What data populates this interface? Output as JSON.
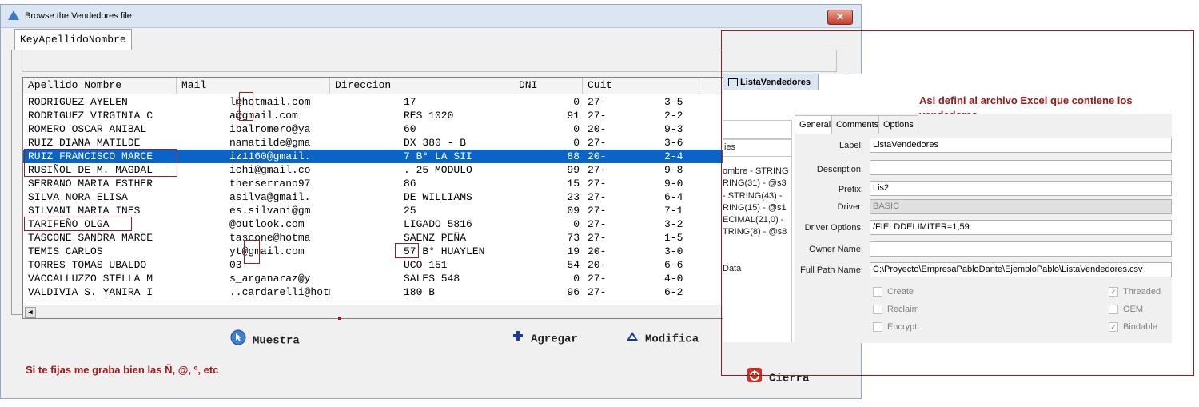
{
  "window": {
    "title": "Browse the Vendedores file",
    "close_label": "✕"
  },
  "tab": {
    "label": "KeyApellidoNombre"
  },
  "grid": {
    "columns": [
      "Apellido Nombre",
      "Mail",
      "Direccion",
      "DNI",
      "Cuit"
    ],
    "rows": [
      {
        "c1": "RODRIGUEZ AYELEN",
        "c2": "l@hotmail.com",
        "c3": "17",
        "c4": "0",
        "c5": "27-",
        "c6": "3-5"
      },
      {
        "c1": "RODRIGUEZ VIRGINIA C",
        "c2": "a@gmail.com",
        "c3": "RES 1020",
        "c4": "91",
        "c5": "27-",
        "c6": "2-2"
      },
      {
        "c1": "ROMERO OSCAR ANIBAL",
        "c2": "ibalromero@ya",
        "c3": "60",
        "c4": "0",
        "c5": "20-",
        "c6": "9-3"
      },
      {
        "c1": "RUIZ DIANA MATILDE",
        "c2": "namatilde@gma",
        "c3": "DX 380 - B",
        "c4": "0",
        "c5": "27-",
        "c6": "3-6"
      },
      {
        "c1": "RUIZ FRANCISCO MARCE",
        "c2": "iz1160@gmail.",
        "c3": "7 B° LA SII",
        "c4": "88",
        "c5": "20-",
        "c6": "2-4"
      },
      {
        "c1": "RUSIÑOL DE M. MAGDAL",
        "c2": "ichi@gmail.co",
        "c3": ". 25 MODULO",
        "c4": "99",
        "c5": "27-",
        "c6": "9-8"
      },
      {
        "c1": "SERRANO MARIA ESTHER",
        "c2": "therserrano97",
        "c3": "86",
        "c4": "15",
        "c5": "27-",
        "c6": "9-0"
      },
      {
        "c1": "SILVA NORA ELISA",
        "c2": "asilva@gmail.",
        "c3": "DE WILLIAMS",
        "c4": "23",
        "c5": "27-",
        "c6": "6-4"
      },
      {
        "c1": "SILVANI MARIA INES",
        "c2": "es.silvani@gm",
        "c3": "25",
        "c4": "09",
        "c5": "27-",
        "c6": "7-1"
      },
      {
        "c1": "TARIFEÑO OLGA",
        "c2": "@outlook.com",
        "c3": "LIGADO 5816",
        "c4": "0",
        "c5": "27-",
        "c6": "3-2"
      },
      {
        "c1": "TASCONE SANDRA MARCE",
        "c2": "tascone@hotma",
        "c3": "SAENZ PEÑA",
        "c4": "73",
        "c5": "27-",
        "c6": "1-5"
      },
      {
        "c1": "TEMIS CARLOS",
        "c2": "yt@gmail.com",
        "c3": "57 B° HUAYLEN",
        "c4": "19",
        "c5": "20-",
        "c6": "3-0"
      },
      {
        "c1": "TORRES TOMAS UBALDO",
        "c2": "03",
        "c3": "UCO 151",
        "c4": "54",
        "c5": "20-",
        "c6": "6-6"
      },
      {
        "c1": "VACCALLUZZO STELLA M",
        "c2": "s_arganaraz@y",
        "c3": "SALES 548",
        "c4": "0",
        "c5": "27-",
        "c6": "4-0"
      },
      {
        "c1": "VALDIVIA S. YANIRA I",
        "c2": "..cardarelli@hotmail.",
        "c3": "180 B",
        "c4": "96",
        "c5": "27-",
        "c6": "6-2"
      }
    ]
  },
  "buttons": {
    "muestra": "Muestra",
    "agregar": "Agregar",
    "modifica": "Modifica",
    "cierra": "Cierra"
  },
  "annotations": {
    "left": "Si te fijas me graba bien las Ñ, @, º, etc",
    "right_line1": "Asi defini al archivo Excel que contiene los",
    "right_line2": "vendedores"
  },
  "dictionary": {
    "tab_label": "ListaVendedores",
    "tree_items": [
      "ies",
      "ombre - STRING",
      "RING(31) - @s3",
      "- STRING(43) -",
      "RING(15) - @s1",
      "ECIMAL(21,0) -",
      "TRING(8) - @s8",
      "Data"
    ],
    "prop_tabs": [
      "General",
      "Comments",
      "Options"
    ],
    "fields": {
      "label_lbl": "Label:",
      "label_val": "ListaVendedores",
      "desc_lbl": "Description:",
      "desc_val": "",
      "prefix_lbl": "Prefix:",
      "prefix_val": "Lis2",
      "driver_lbl": "Driver:",
      "driver_val": "BASIC",
      "dopt_lbl": "Driver Options:",
      "dopt_val": "/FIELDDELIMITER=1,59",
      "owner_lbl": "Owner Name:",
      "owner_val": "",
      "path_lbl": "Full Path Name:",
      "path_val": "C:\\Proyecto\\EmpresaPabloDante\\EjemploPablo\\ListaVendedores.csv"
    },
    "checks": {
      "create": "Create",
      "reclaim": "Reclaim",
      "encrypt": "Encrypt",
      "threaded": "Threaded",
      "oem": "OEM",
      "bindable": "Bindable"
    }
  }
}
